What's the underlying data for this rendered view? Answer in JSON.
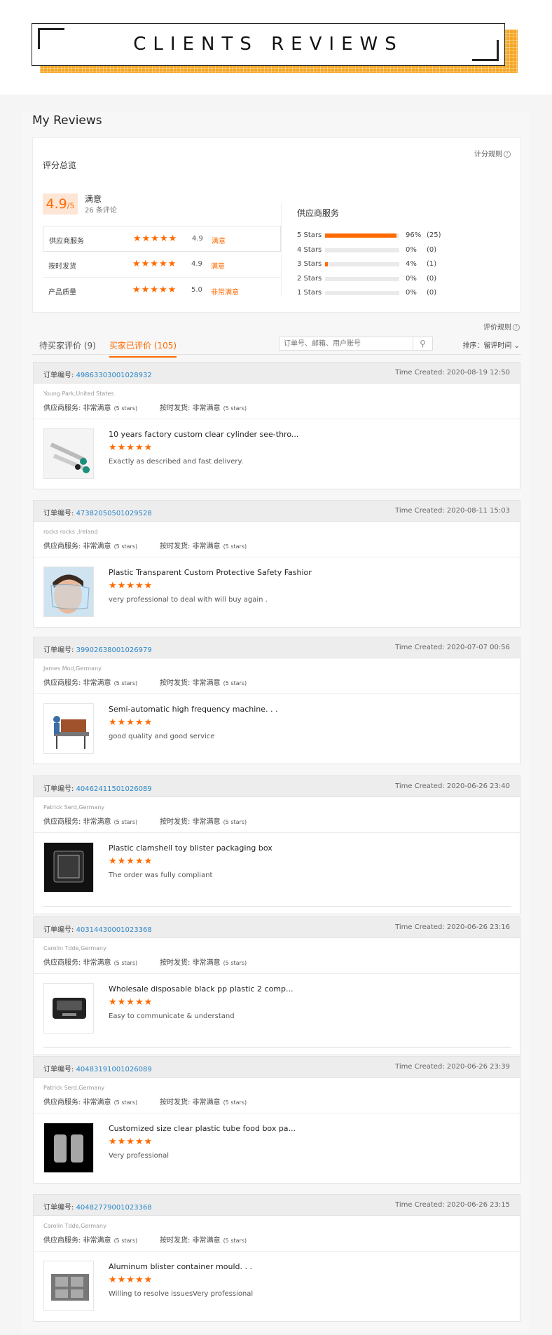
{
  "banner": {
    "title": "CLIENTS REVIEWS"
  },
  "page_title": "My Reviews",
  "summary": {
    "rules_link": "计分规则",
    "label": "评分总览",
    "score": "4.9",
    "score_suffix": "/5",
    "satisfaction": "满意",
    "review_count": "26 条评论",
    "ratings": [
      {
        "label": "供应商服务",
        "stars": "★★★★★",
        "value": "4.9",
        "sat": "满意"
      },
      {
        "label": "按时发货",
        "stars": "★★★★★",
        "value": "4.9",
        "sat": "满意"
      },
      {
        "label": "产品质量",
        "stars": "★★★★★",
        "value": "5.0",
        "sat": "非常满意"
      }
    ],
    "service_title": "供应商服务",
    "distribution": [
      {
        "label": "5 Stars",
        "fill": 96,
        "pct": "96%",
        "count": "(25)"
      },
      {
        "label": "4 Stars",
        "fill": 0,
        "pct": "0%",
        "count": "(0)"
      },
      {
        "label": "3 Stars",
        "fill": 4,
        "pct": "4%",
        "count": "(1)"
      },
      {
        "label": "2 Stars",
        "fill": 0,
        "pct": "0%",
        "count": "(0)"
      },
      {
        "label": "1 Stars",
        "fill": 0,
        "pct": "0%",
        "count": "(0)"
      }
    ]
  },
  "eval_rules": "评价规则",
  "tabs": {
    "pending": "待买家评价 (9)",
    "reviewed": "买家已评价 (105)"
  },
  "search": {
    "placeholder": "订单号、邮箱、用户账号"
  },
  "sort": "排序：留评时间",
  "order_label": "订单编号:",
  "time_label": "Time Created:",
  "svc_label": "供应商服务: 非常满意",
  "ship_label": "按时发货: 非常满意",
  "stars_note": "(5 stars)",
  "review_stars": "★★★★★",
  "reviews": [
    {
      "order_no": "49863303001028932",
      "time": "2020-08-19 12:50",
      "buyer": "Young Park,United States",
      "title": "10 years factory custom clear cylinder see-thro...",
      "comment": "Exactly as described and fast delivery."
    },
    {
      "order_no": "47382050501029528",
      "time": "2020-08-11 15:03",
      "buyer": "rocks rocks ,Ireland",
      "title": "Plastic Transparent Custom Protective Safety Fashion...",
      "comment": "very professional to deal with will buy again ."
    },
    {
      "order_no": "39902638001026979",
      "time": "2020-07-07 00:56",
      "buyer": "James Mod,Germany",
      "title": "Semi-automatic high frequency machine. . .",
      "comment": "good quality and good service"
    },
    {
      "order_no": "40462411501026089",
      "time": "2020-06-26 23:40",
      "buyer": "Patrick Serd,Germany",
      "title": "Plastic clamshell toy blister packaging box",
      "comment": "The order was fully compliant"
    },
    {
      "order_no": "40314430001023368",
      "time": "2020-06-26 23:16",
      "buyer": "Carolin Tdde,Germany",
      "title": "Wholesale disposable black pp plastic 2 comp...",
      "comment": "Easy to communicate & understand"
    },
    {
      "order_no": "40483191001026089",
      "time": "2020-06-26 23:39",
      "buyer": "Patrick Serd,Germany",
      "title": "Customized size clear plastic tube food box pa...",
      "comment": "Very professional"
    },
    {
      "order_no": "40482779001023368",
      "time": "2020-06-26 23:15",
      "buyer": "Carolin Tdde,Germany",
      "title": "Aluminum blister container mould. . .",
      "comment": "Willing to resolve issuesVery professional"
    }
  ]
}
